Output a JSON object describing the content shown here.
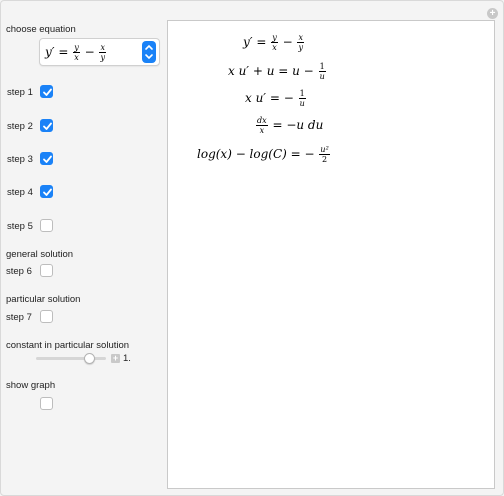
{
  "controls": {
    "choose_equation_label": "choose equation",
    "steps": [
      {
        "label": "step 1",
        "checked": true
      },
      {
        "label": "step 2",
        "checked": true
      },
      {
        "label": "step 3",
        "checked": true
      },
      {
        "label": "step 4",
        "checked": true
      },
      {
        "label": "step 5",
        "checked": false
      }
    ],
    "general_solution_label": "general solution",
    "step6": {
      "label": "step 6",
      "checked": false
    },
    "particular_solution_label": "particular solution",
    "step7": {
      "label": "step 7",
      "checked": false
    },
    "constant_label": "constant in particular solution",
    "constant_value": "1.",
    "constant_slider_fraction": 0.77,
    "show_graph_label": "show graph",
    "show_graph_checked": false
  },
  "selected_equation": {
    "lhs": "y′ =",
    "f1_num": "y",
    "f1_den": "x",
    "minus": "−",
    "f2_num": "x",
    "f2_den": "y"
  },
  "output": {
    "line1": {
      "lhs": "y′ =",
      "f1n": "y",
      "f1d": "x",
      "op": "−",
      "f2n": "x",
      "f2d": "y"
    },
    "line2": {
      "text": "x u′ + u = u −",
      "fn": "1",
      "fd": "u"
    },
    "line3": {
      "text": "x u′ = −",
      "fn": "1",
      "fd": "u"
    },
    "line4": {
      "fn": "dx",
      "fd": "x",
      "rhs": "= −u du"
    },
    "line5": {
      "text": "log(x) − log(C) = −",
      "fn": "u²",
      "fd": "2"
    }
  },
  "colors": {
    "accent": "#1a82f7"
  }
}
